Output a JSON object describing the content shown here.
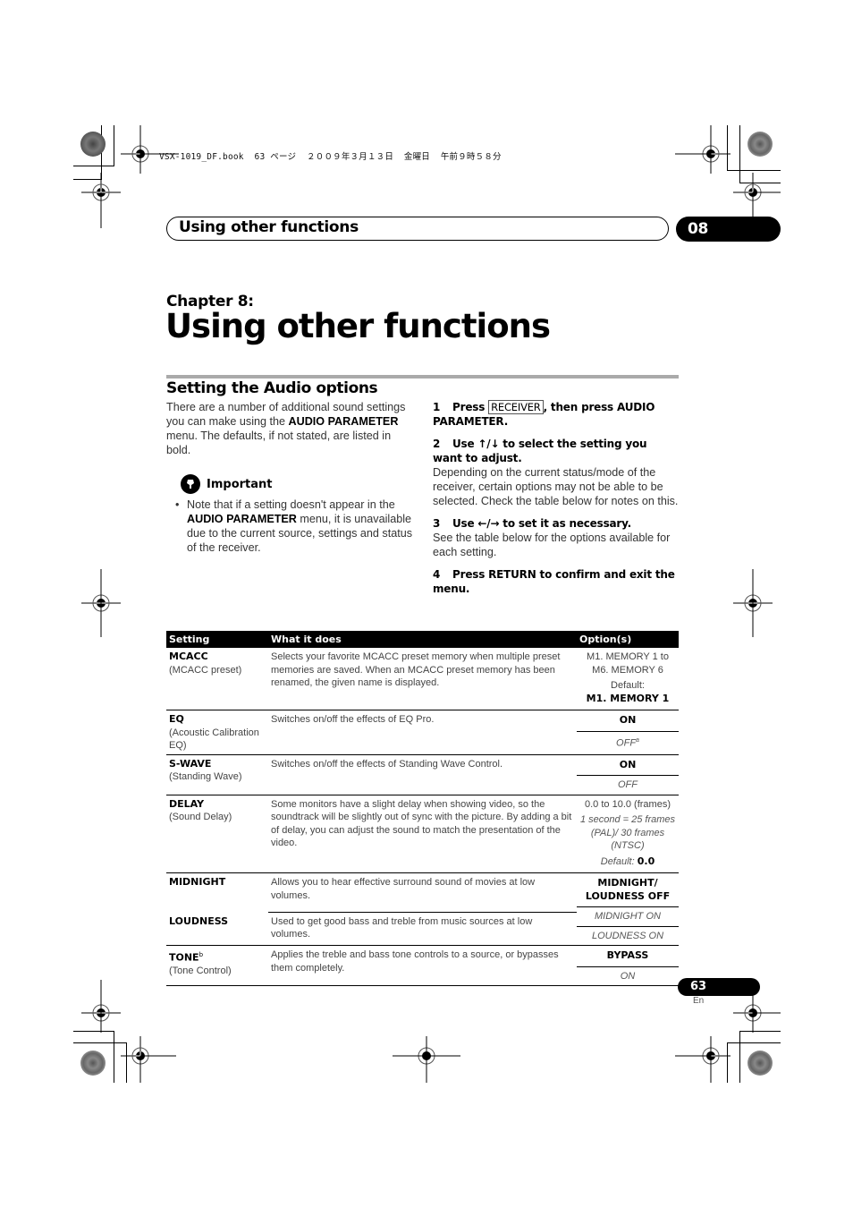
{
  "print_info": "VSX-1019_DF.book  63 ページ  ２００９年３月１３日  金曜日  午前９時５８分",
  "header": {
    "title": "Using other functions",
    "chapter_number": "08"
  },
  "chapter": {
    "label": "Chapter 8:",
    "title": "Using other functions"
  },
  "section": {
    "title": "Setting the Audio options",
    "intro": {
      "part1": "There are a number of additional sound settings you can make using the ",
      "bold1": "AUDIO PARAMETER",
      "part2": " menu. The defaults, if not stated, are listed in bold."
    },
    "important": {
      "label": "Important",
      "icon": "pen-hand-icon",
      "bullet": {
        "part1": "Note that if a setting doesn't appear in the ",
        "bold": "AUDIO PARAMETER",
        "part2": " menu, it is unavailable due to the current source, settings and status of the receiver."
      }
    },
    "steps": [
      {
        "num": "1",
        "pre": "Press ",
        "key": "RECEIVER",
        "post": ", then press AUDIO PARAMETER.",
        "desc": ""
      },
      {
        "num": "2",
        "pre": "Use ",
        "arrows": "↑/↓",
        "post": " to select the setting you want to adjust.",
        "desc": "Depending on the current status/mode of the receiver, certain options may not be able to be selected. Check the table below for notes on this."
      },
      {
        "num": "3",
        "pre": "Use ",
        "arrows": "←/→",
        "post": " to set it as necessary.",
        "desc": "See the table below for the options available for each setting."
      },
      {
        "num": "4",
        "pre": "Press RETURN to confirm and exit the menu.",
        "post": "",
        "desc": ""
      }
    ]
  },
  "table": {
    "headers": [
      "Setting",
      "What it does",
      "Option(s)"
    ],
    "rows": [
      {
        "name": "MCACC",
        "sub": "(MCACC preset)",
        "desc": "Selects your favorite MCACC preset memory when multiple preset memories are saved. When an MCACC preset memory has been renamed, the given name is displayed.",
        "options": [
          "M1. MEMORY 1 to M6. MEMORY 6",
          "Default:",
          "M1. MEMORY 1"
        ]
      },
      {
        "name": "EQ",
        "sub": "(Acoustic Calibration EQ)",
        "desc": "Switches on/off the effects of EQ Pro.",
        "options": [
          "ON",
          "OFF"
        ],
        "footnote": "a"
      },
      {
        "name": "S-WAVE",
        "sub": "(Standing Wave)",
        "desc": "Switches on/off the effects of Standing Wave Control.",
        "options": [
          "ON",
          "OFF"
        ]
      },
      {
        "name": "DELAY",
        "sub": "(Sound Delay)",
        "desc": "Some monitors have a slight delay when showing video, so the soundtrack will be slightly out of sync with the picture. By adding a bit of delay, you can adjust the sound to match the presentation of the video.",
        "options": [
          "0.0 to 10.0 (frames)",
          "1 second = 25 frames (PAL)/ 30 frames (NTSC)",
          "Default:",
          "0.0"
        ]
      },
      {
        "name": "MIDNIGHT",
        "desc": "Allows you to hear effective surround sound of movies at low volumes.",
        "options": [
          "MIDNIGHT/ LOUDNESS OFF",
          "MIDNIGHT ON",
          "LOUDNESS ON"
        ]
      },
      {
        "name": "LOUDNESS",
        "desc": "Used to get good bass and treble from music sources at low volumes."
      },
      {
        "name": "TONE",
        "footnote": "b",
        "sub": "(Tone Control)",
        "desc": "Applies the treble and bass tone controls to a source, or bypasses them completely.",
        "options": [
          "BYPASS",
          "ON"
        ]
      }
    ]
  },
  "footer": {
    "page_number": "63",
    "language": "En"
  }
}
